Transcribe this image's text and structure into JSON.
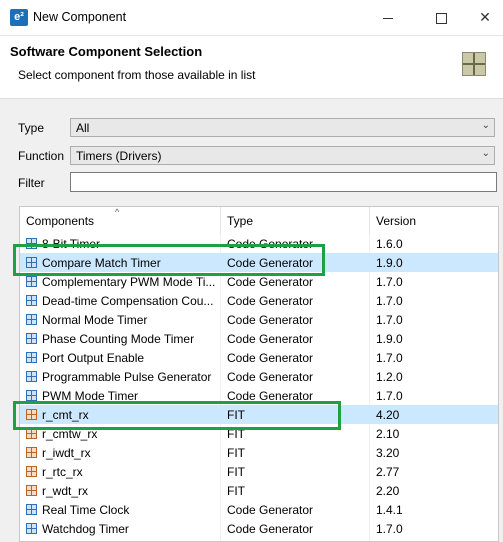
{
  "window": {
    "title": "New Component",
    "app_icon": "e²"
  },
  "header": {
    "title": "Software Component Selection",
    "description": "Select component from those available in list"
  },
  "form": {
    "type_label": "Type",
    "type_value": "All",
    "function_label": "Function",
    "function_value": "Timers (Drivers)",
    "filter_label": "Filter",
    "filter_value": ""
  },
  "table": {
    "headers": {
      "components": "Components",
      "type": "Type",
      "version": "Version"
    },
    "rows": [
      {
        "name": "8-Bit Timer",
        "type": "Code Generator",
        "version": "1.6.0",
        "icon": "code-generator-icon"
      },
      {
        "name": "Compare Match Timer",
        "type": "Code Generator",
        "version": "1.9.0",
        "icon": "code-generator-icon"
      },
      {
        "name": "Complementary PWM Mode Ti...",
        "type": "Code Generator",
        "version": "1.7.0",
        "icon": "code-generator-icon"
      },
      {
        "name": "Dead-time Compensation Cou...",
        "type": "Code Generator",
        "version": "1.7.0",
        "icon": "code-generator-icon"
      },
      {
        "name": "Normal Mode Timer",
        "type": "Code Generator",
        "version": "1.7.0",
        "icon": "code-generator-icon"
      },
      {
        "name": "Phase Counting Mode Timer",
        "type": "Code Generator",
        "version": "1.9.0",
        "icon": "code-generator-icon"
      },
      {
        "name": "Port Output Enable",
        "type": "Code Generator",
        "version": "1.7.0",
        "icon": "code-generator-icon"
      },
      {
        "name": "Programmable Pulse Generator",
        "type": "Code Generator",
        "version": "1.2.0",
        "icon": "code-generator-icon"
      },
      {
        "name": "PWM Mode Timer",
        "type": "Code Generator",
        "version": "1.7.0",
        "icon": "code-generator-icon"
      },
      {
        "name": "r_cmt_rx",
        "type": "FIT",
        "version": "4.20",
        "icon": "fit-module-icon"
      },
      {
        "name": "r_cmtw_rx",
        "type": "FIT",
        "version": "2.10",
        "icon": "fit-module-icon"
      },
      {
        "name": "r_iwdt_rx",
        "type": "FIT",
        "version": "3.20",
        "icon": "fit-module-icon"
      },
      {
        "name": "r_rtc_rx",
        "type": "FIT",
        "version": "2.77",
        "icon": "fit-module-icon"
      },
      {
        "name": "r_wdt_rx",
        "type": "FIT",
        "version": "2.20",
        "icon": "fit-module-icon"
      },
      {
        "name": "Real Time Clock",
        "type": "Code Generator",
        "version": "1.4.1",
        "icon": "code-generator-icon"
      },
      {
        "name": "Watchdog Timer",
        "type": "Code Generator",
        "version": "1.7.0",
        "icon": "code-generator-icon"
      }
    ]
  },
  "colors": {
    "selection": "#cce8ff",
    "highlight_box": "#1fa046"
  }
}
